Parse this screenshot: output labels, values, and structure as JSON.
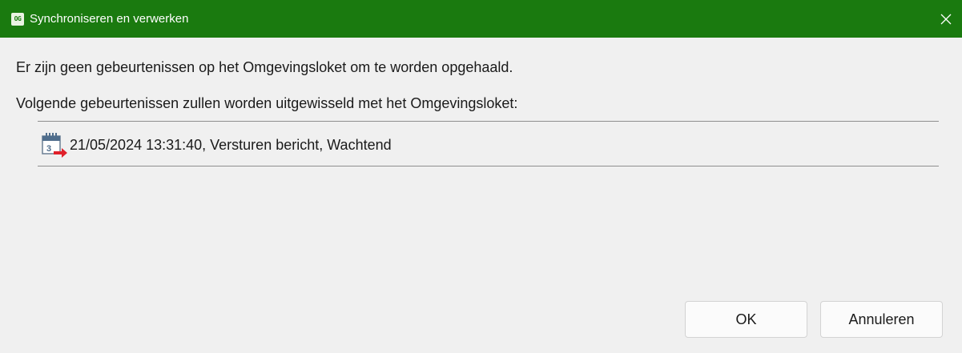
{
  "window": {
    "title": "Synchroniseren en verwerken",
    "icon_text": "OG",
    "close_icon": "close-icon"
  },
  "messages": {
    "line1": "Er zijn geen gebeurtenissen op het Omgevingsloket om te worden opgehaald.",
    "line2": "Volgende gebeurtenissen zullen worden uitgewisseld met het Omgevingsloket:"
  },
  "events": [
    {
      "icon": "calendar-send-icon",
      "text": "21/05/2024 13:31:40, Versturen bericht, Wachtend"
    }
  ],
  "buttons": {
    "ok_label": "OK",
    "cancel_label": "Annuleren"
  },
  "colors": {
    "titlebar": "#1a7a0f",
    "background": "#f0f0f0",
    "arrow": "#e0202a"
  }
}
